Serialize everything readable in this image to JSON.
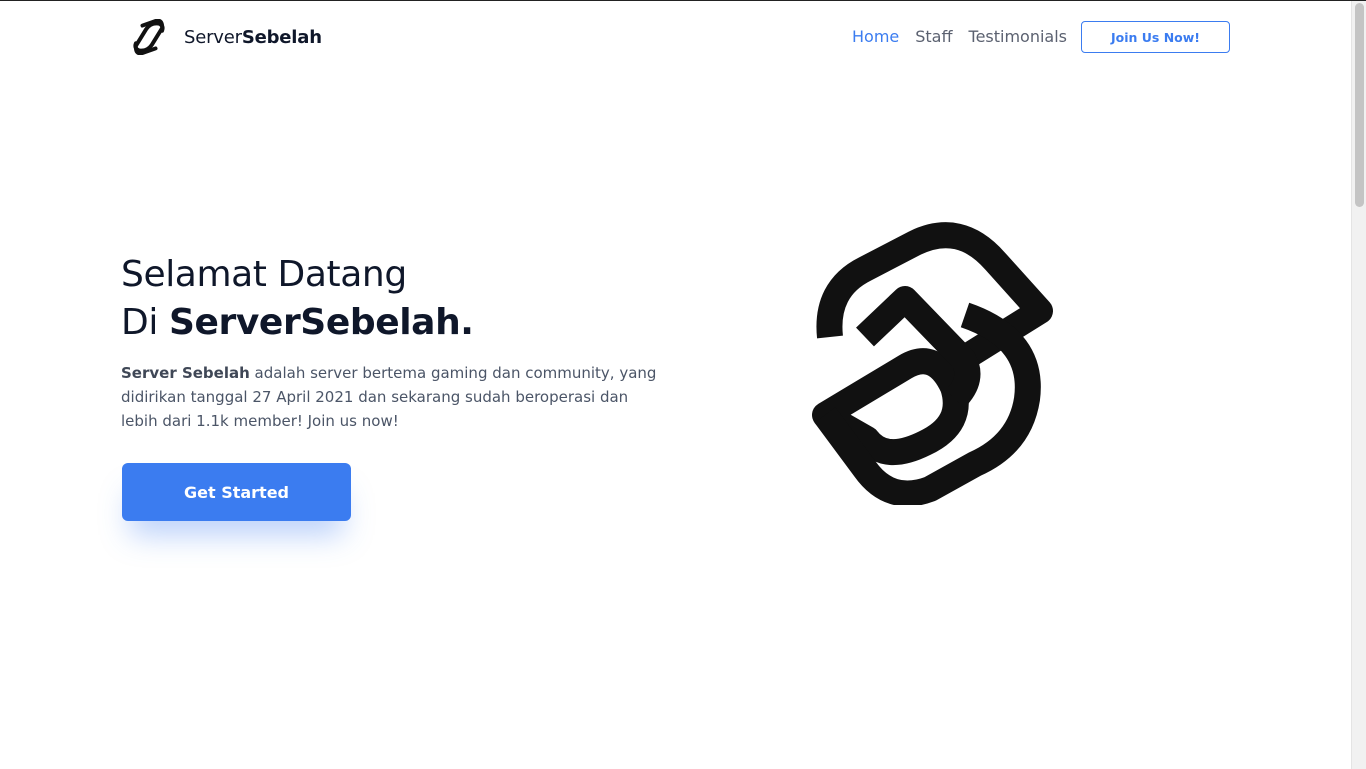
{
  "header": {
    "brand_part1": "Server",
    "brand_part2": "Sebelah",
    "nav": [
      {
        "label": "Home",
        "active": true
      },
      {
        "label": "Staff",
        "active": false
      },
      {
        "label": "Testimonials",
        "active": false
      }
    ],
    "join_label": "Join Us Now!"
  },
  "hero": {
    "title_line1": "Selamat Datang",
    "title_line2_prefix": "Di ",
    "title_line2_brand": "ServerSebelah.",
    "desc_bold": "Server Sebelah",
    "desc_rest": " adalah server bertema gaming dan community, yang didirikan tanggal 27 April 2021 dan sekarang sudah beroperasi dan lebih dari 1.1k member! Join us now!",
    "cta_label": "Get Started"
  },
  "colors": {
    "accent": "#3b7cf0",
    "text_dark": "#0f172a",
    "text_muted": "#4b5567"
  },
  "icons": {
    "brand_logo": "serversebelah-logo-icon",
    "hero_logo": "serversebelah-logo-icon"
  }
}
